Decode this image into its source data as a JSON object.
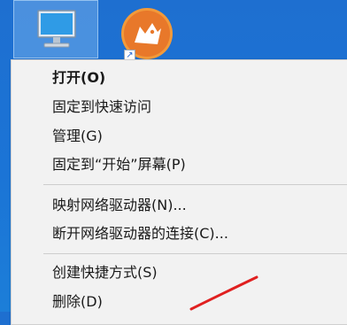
{
  "desktop": {
    "icons": [
      {
        "name": "this-pc",
        "icon": "computer-monitor-icon"
      },
      {
        "name": "browser",
        "icon": "cheetah-browser-icon",
        "color": "#e8782a"
      }
    ]
  },
  "context_menu": {
    "items": [
      {
        "label": "打开(O)",
        "bold": true
      },
      {
        "label": "固定到快速访问"
      },
      {
        "label": "管理(G)"
      },
      {
        "label": "固定到“开始”屏幕(P)"
      },
      {
        "label": "映射网络驱动器(N)..."
      },
      {
        "label": "断开网络驱动器的连接(C)..."
      },
      {
        "label": "创建快捷方式(S)"
      },
      {
        "label": "删除(D)"
      }
    ]
  },
  "colors": {
    "desktop_bg": "#1e6fd0",
    "menu_bg": "#f2f2f2",
    "annotation_arrow": "#e02020"
  }
}
